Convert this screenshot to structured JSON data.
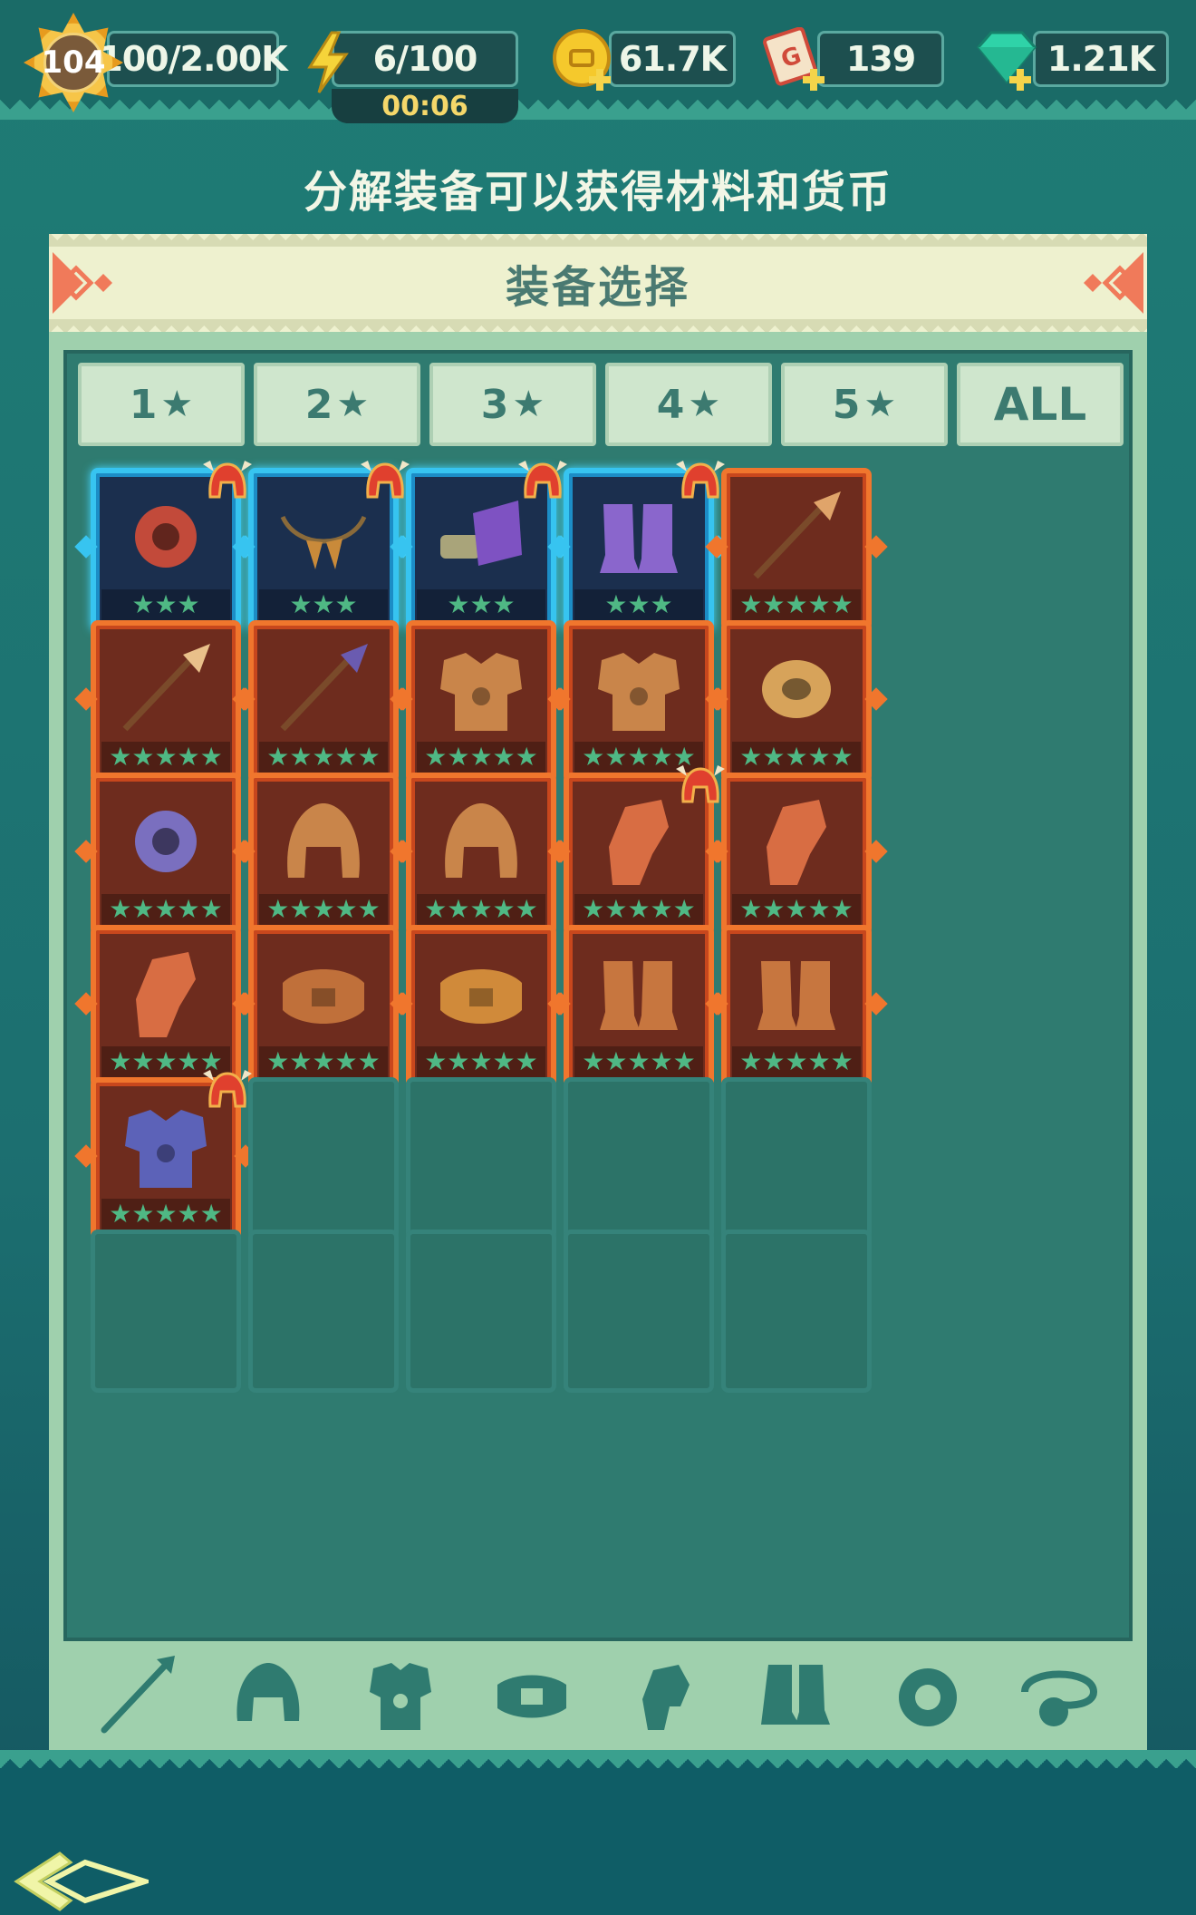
{
  "top_bar": {
    "level": "104",
    "experience": "100/2.00K",
    "energy": "6/100",
    "energy_timer": "00:06",
    "gold": "61.7K",
    "tickets": "139",
    "gems": "1.21K"
  },
  "headline": "分解装备可以获得材料和货币",
  "panel": {
    "title": "装备选择",
    "tabs": [
      {
        "label": "1",
        "star": "★"
      },
      {
        "label": "2",
        "star": "★"
      },
      {
        "label": "3",
        "star": "★"
      },
      {
        "label": "4",
        "star": "★"
      },
      {
        "label": "5",
        "star": "★"
      },
      {
        "label": "ALL",
        "star": ""
      }
    ],
    "items": [
      {
        "name": "ring",
        "rarity": "blue",
        "stars": "★★★",
        "helmet_badge": true,
        "color": "#c24a3a"
      },
      {
        "name": "fang-necklace",
        "rarity": "blue",
        "stars": "★★★",
        "helmet_badge": true,
        "color": "#c98a3a"
      },
      {
        "name": "gauntlet",
        "rarity": "blue",
        "stars": "★★★",
        "helmet_badge": true,
        "color": "#7e52c2"
      },
      {
        "name": "boots",
        "rarity": "blue",
        "stars": "★★★",
        "helmet_badge": true,
        "color": "#8a66cc"
      },
      {
        "name": "spear",
        "rarity": "orange",
        "stars": "★★★★★",
        "helmet_badge": false,
        "color": "#e0a46a"
      },
      {
        "name": "spear",
        "rarity": "orange",
        "stars": "★★★★★",
        "helmet_badge": false,
        "color": "#e9c08a"
      },
      {
        "name": "dark-spear",
        "rarity": "orange",
        "stars": "★★★★★",
        "helmet_badge": false,
        "color": "#6a5bb0"
      },
      {
        "name": "armor",
        "rarity": "orange",
        "stars": "★★★★★",
        "helmet_badge": false,
        "color": "#c9854a"
      },
      {
        "name": "armor",
        "rarity": "orange",
        "stars": "★★★★★",
        "helmet_badge": false,
        "color": "#c9854a"
      },
      {
        "name": "bracelet",
        "rarity": "orange",
        "stars": "★★★★★",
        "helmet_badge": false,
        "color": "#d7a35a"
      },
      {
        "name": "ring",
        "rarity": "orange",
        "stars": "★★★★★",
        "helmet_badge": false,
        "color": "#7a6fbf"
      },
      {
        "name": "helmet",
        "rarity": "orange",
        "stars": "★★★★★",
        "helmet_badge": false,
        "color": "#c9854a"
      },
      {
        "name": "helmet",
        "rarity": "orange",
        "stars": "★★★★★",
        "helmet_badge": false,
        "color": "#c9854a"
      },
      {
        "name": "glove",
        "rarity": "orange",
        "stars": "★★★★★",
        "helmet_badge": true,
        "color": "#d86d43"
      },
      {
        "name": "glove",
        "rarity": "orange",
        "stars": "★★★★★",
        "helmet_badge": false,
        "color": "#d86d43"
      },
      {
        "name": "glove",
        "rarity": "orange",
        "stars": "★★★★★",
        "helmet_badge": false,
        "color": "#d86d43"
      },
      {
        "name": "belt",
        "rarity": "orange",
        "stars": "★★★★★",
        "helmet_badge": false,
        "color": "#c0703a"
      },
      {
        "name": "belt",
        "rarity": "orange",
        "stars": "★★★★★",
        "helmet_badge": false,
        "color": "#d08a3a"
      },
      {
        "name": "greaves",
        "rarity": "orange",
        "stars": "★★★★★",
        "helmet_badge": false,
        "color": "#c7763f"
      },
      {
        "name": "greaves",
        "rarity": "orange",
        "stars": "★★★★★",
        "helmet_badge": false,
        "color": "#c7763f"
      },
      {
        "name": "chest-armor",
        "rarity": "orange",
        "stars": "★★★★★",
        "helmet_badge": true,
        "color": "#5c62b8"
      }
    ],
    "empty_slots": 9
  },
  "categories": [
    "weapon-icon",
    "helmet-icon",
    "armor-icon",
    "belt-icon",
    "glove-icon",
    "boots-icon",
    "ring-icon",
    "necklace-icon"
  ],
  "colors": {
    "background": "#1f7c75",
    "panel": "#9fd0ad",
    "header": "#eef1cf",
    "rarity_blue": "#37c4f0",
    "rarity_orange": "#f0762d",
    "star_green": "#4fb884"
  }
}
